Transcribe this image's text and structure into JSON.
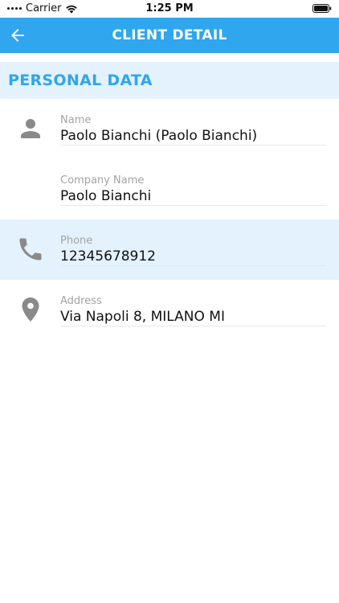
{
  "status_bar": {
    "carrier": "Carrier",
    "time": "1:25 PM",
    "icons": [
      "wifi-icon",
      "battery-icon"
    ]
  },
  "app_bar": {
    "title": "CLIENT DETAIL",
    "back_icon": "arrow-left-icon",
    "background": "#2fa6ee"
  },
  "section": {
    "title": "PERSONAL DATA",
    "background": "#e3f2fd",
    "color": "#2fa6ee"
  },
  "fields": [
    {
      "label": "Name",
      "value": "Paolo Bianchi (Paolo Bianchi)",
      "icon": "person-icon"
    },
    {
      "label": "Company Name",
      "value": "Paolo Bianchi",
      "icon": ""
    },
    {
      "label": "Phone",
      "value": "12345678912",
      "icon": "phone-icon"
    },
    {
      "label": "Address",
      "value": "Via Napoli 8,  MILANO MI",
      "icon": "location-pin-icon"
    }
  ]
}
